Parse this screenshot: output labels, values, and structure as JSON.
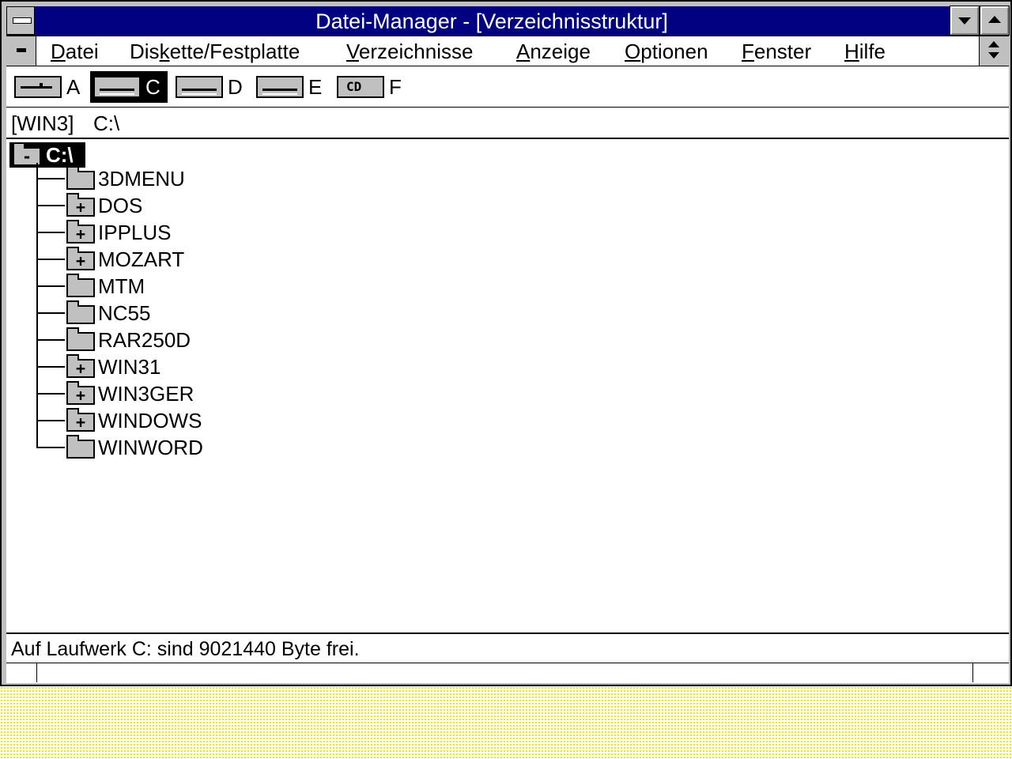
{
  "window": {
    "title": "Datei-Manager - [Verzeichnisstruktur]"
  },
  "menu": {
    "items": [
      {
        "pre": "",
        "u": "D",
        "post": "atei"
      },
      {
        "pre": "Dis",
        "u": "k",
        "post": "ette/Festplatte"
      },
      {
        "pre": "",
        "u": "V",
        "post": "erzeichnisse"
      },
      {
        "pre": "",
        "u": "A",
        "post": "nzeige"
      },
      {
        "pre": "",
        "u": "O",
        "post": "ptionen"
      },
      {
        "pre": "",
        "u": "F",
        "post": "enster"
      },
      {
        "pre": "",
        "u": "H",
        "post": "ilfe"
      }
    ]
  },
  "drives": [
    {
      "letter": "A",
      "icon": "floppy-drive-icon",
      "selected": false
    },
    {
      "letter": "C",
      "icon": "hard-drive-icon",
      "selected": true
    },
    {
      "letter": "D",
      "icon": "hard-drive-icon",
      "selected": false
    },
    {
      "letter": "E",
      "icon": "hard-drive-icon",
      "selected": false
    },
    {
      "letter": "F",
      "icon": "cdrom-drive-icon",
      "selected": false,
      "icon_text": "CD"
    }
  ],
  "path": {
    "label": "[WIN3]",
    "value": "C:\\"
  },
  "tree": {
    "root": {
      "label": "C:\\",
      "sign": "-"
    },
    "folders": [
      {
        "name": "3DMENU",
        "sign": ""
      },
      {
        "name": "DOS",
        "sign": "+"
      },
      {
        "name": "IPPLUS",
        "sign": "+"
      },
      {
        "name": "MOZART",
        "sign": "+"
      },
      {
        "name": "MTM",
        "sign": ""
      },
      {
        "name": "NC55",
        "sign": ""
      },
      {
        "name": "RAR250D",
        "sign": ""
      },
      {
        "name": "WIN31",
        "sign": "+"
      },
      {
        "name": "WIN3GER",
        "sign": "+"
      },
      {
        "name": "WINDOWS",
        "sign": "+"
      },
      {
        "name": "WINWORD",
        "sign": ""
      }
    ]
  },
  "status": {
    "text": "Auf Laufwerk C: sind 9021440 Byte frei."
  }
}
